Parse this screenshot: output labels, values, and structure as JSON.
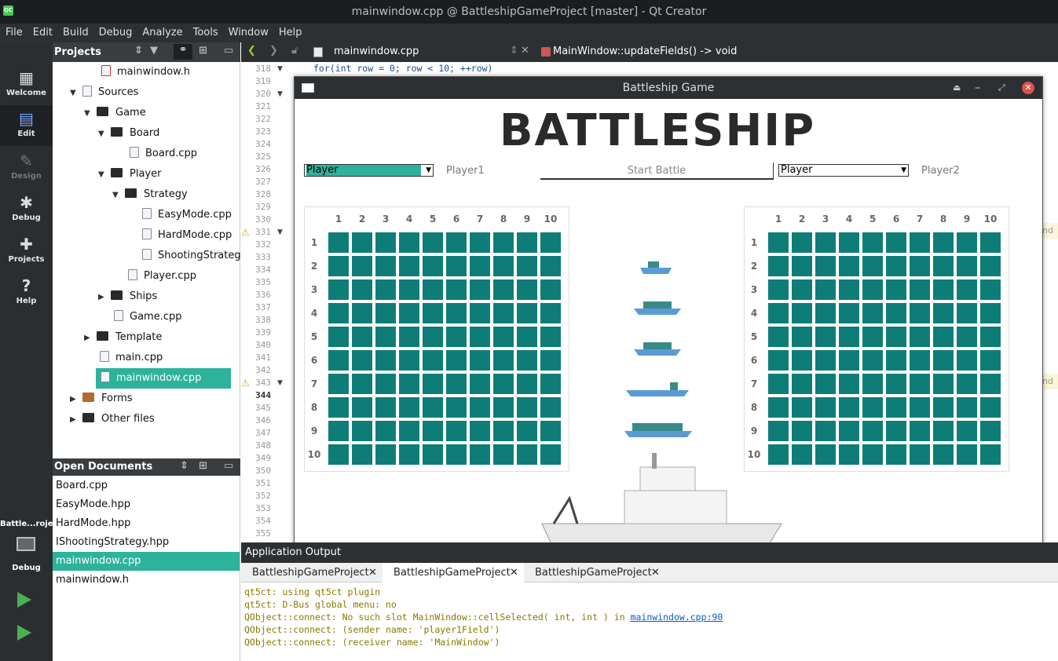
{
  "window": {
    "title": "mainwindow.cpp @ BattleshipGameProject [master] - Qt Creator",
    "logo": "QC"
  },
  "menu": [
    "File",
    "Edit",
    "Build",
    "Debug",
    "Analyze",
    "Tools",
    "Window",
    "Help"
  ],
  "modes": [
    {
      "label": "Welcome",
      "icon": "grid-icon"
    },
    {
      "label": "Edit",
      "icon": "edit-icon"
    },
    {
      "label": "Design",
      "icon": "design-icon"
    },
    {
      "label": "Debug",
      "icon": "bug-icon"
    },
    {
      "label": "Projects",
      "icon": "wrench-icon"
    },
    {
      "label": "Help",
      "icon": "help-icon"
    }
  ],
  "kit": {
    "project": "Battle...roject",
    "mode": "Debug"
  },
  "projects": {
    "header": "Projects",
    "tree": [
      {
        "label": "mainwindow.h",
        "kind": "file"
      },
      {
        "label": "Sources",
        "kind": "folder"
      },
      {
        "label": "Game",
        "kind": "folder"
      },
      {
        "label": "Board",
        "kind": "folder"
      },
      {
        "label": "Board.cpp",
        "kind": "file"
      },
      {
        "label": "Player",
        "kind": "folder"
      },
      {
        "label": "Strategy",
        "kind": "folder"
      },
      {
        "label": "EasyMode.cpp",
        "kind": "file"
      },
      {
        "label": "HardMode.cpp",
        "kind": "file"
      },
      {
        "label": "ShootingStrateg",
        "kind": "file"
      },
      {
        "label": "Player.cpp",
        "kind": "file"
      },
      {
        "label": "Ships",
        "kind": "folder"
      },
      {
        "label": "Game.cpp",
        "kind": "file"
      },
      {
        "label": "Template",
        "kind": "folder"
      },
      {
        "label": "main.cpp",
        "kind": "file"
      },
      {
        "label": "mainwindow.cpp",
        "kind": "file"
      },
      {
        "label": "Forms",
        "kind": "folder"
      },
      {
        "label": "Other files",
        "kind": "folder"
      }
    ]
  },
  "open_documents": {
    "header": "Open Documents",
    "items": [
      "Board.cpp",
      "EasyMode.hpp",
      "HardMode.hpp",
      "IShootingStrategy.hpp",
      "mainwindow.cpp",
      "mainwindow.h"
    ],
    "selected": "mainwindow.cpp"
  },
  "editor": {
    "file": "mainwindow.cpp",
    "symbol": "MainWindow::updateFields() -> void",
    "first_line": "for(int row = 0; row < 10; ++row)",
    "line_numbers": [
      "318",
      "319",
      "320",
      "321",
      "322",
      "323",
      "324",
      "325",
      "326",
      "327",
      "328",
      "329",
      "330",
      "331",
      "332",
      "333",
      "334",
      "335",
      "336",
      "337",
      "338",
      "339",
      "340",
      "341",
      "342",
      "343",
      "344",
      "345",
      "346",
      "347",
      "348",
      "349",
      "350",
      "351",
      "352",
      "353",
      "354",
      "355"
    ],
    "right_snippet": "nd"
  },
  "game": {
    "title": "Battleship Game",
    "logo": "BATTLESHIP",
    "p1_combo": "Player",
    "p1_label": "Player1",
    "start_button": "Start Battle",
    "p2_combo": "Player",
    "p2_label": "Player2",
    "columns": [
      "1",
      "2",
      "3",
      "4",
      "5",
      "6",
      "7",
      "8",
      "9",
      "10"
    ],
    "rows": [
      "1",
      "2",
      "3",
      "4",
      "5",
      "6",
      "7",
      "8",
      "9",
      "10"
    ],
    "cell_color": "#0e7d78"
  },
  "output": {
    "header": "Application Output",
    "tabs": [
      "BattleshipGameProject",
      "BattleshipGameProject",
      "BattleshipGameProject"
    ],
    "lines": [
      "qt5ct: using qt5ct plugin",
      "qt5ct: D-Bus global menu: no",
      "QObject::connect: No such slot MainWindow::cellSelected( int, int ) in ",
      "QObject::connect:  (sender name:   'player1Field')",
      "QObject::connect:  (receiver name: 'MainWindow')"
    ],
    "link": "mainwindow.cpp:90"
  }
}
